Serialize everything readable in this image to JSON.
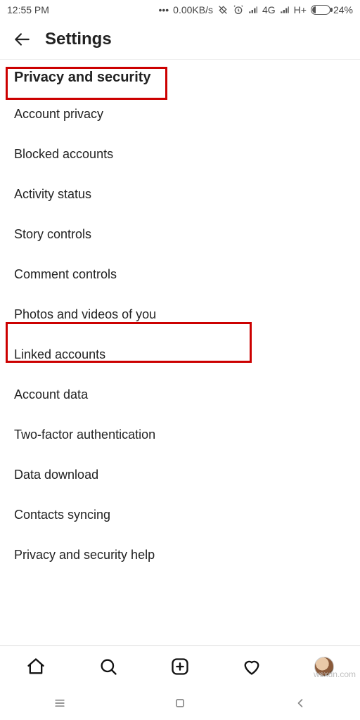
{
  "statusbar": {
    "time": "12:55 PM",
    "net_speed": "0.00KB/s",
    "signal1": "4G",
    "signal2": "H+",
    "battery_pct": "24%"
  },
  "header": {
    "title": "Settings"
  },
  "section": {
    "title": "Privacy and security",
    "items": [
      "Account privacy",
      "Blocked accounts",
      "Activity status",
      "Story controls",
      "Comment controls",
      "Photos and videos of you",
      "Linked accounts",
      "Account data",
      "Two-factor authentication",
      "Data download",
      "Contacts syncing",
      "Privacy and security help"
    ]
  },
  "watermark": "wsxdn.com"
}
